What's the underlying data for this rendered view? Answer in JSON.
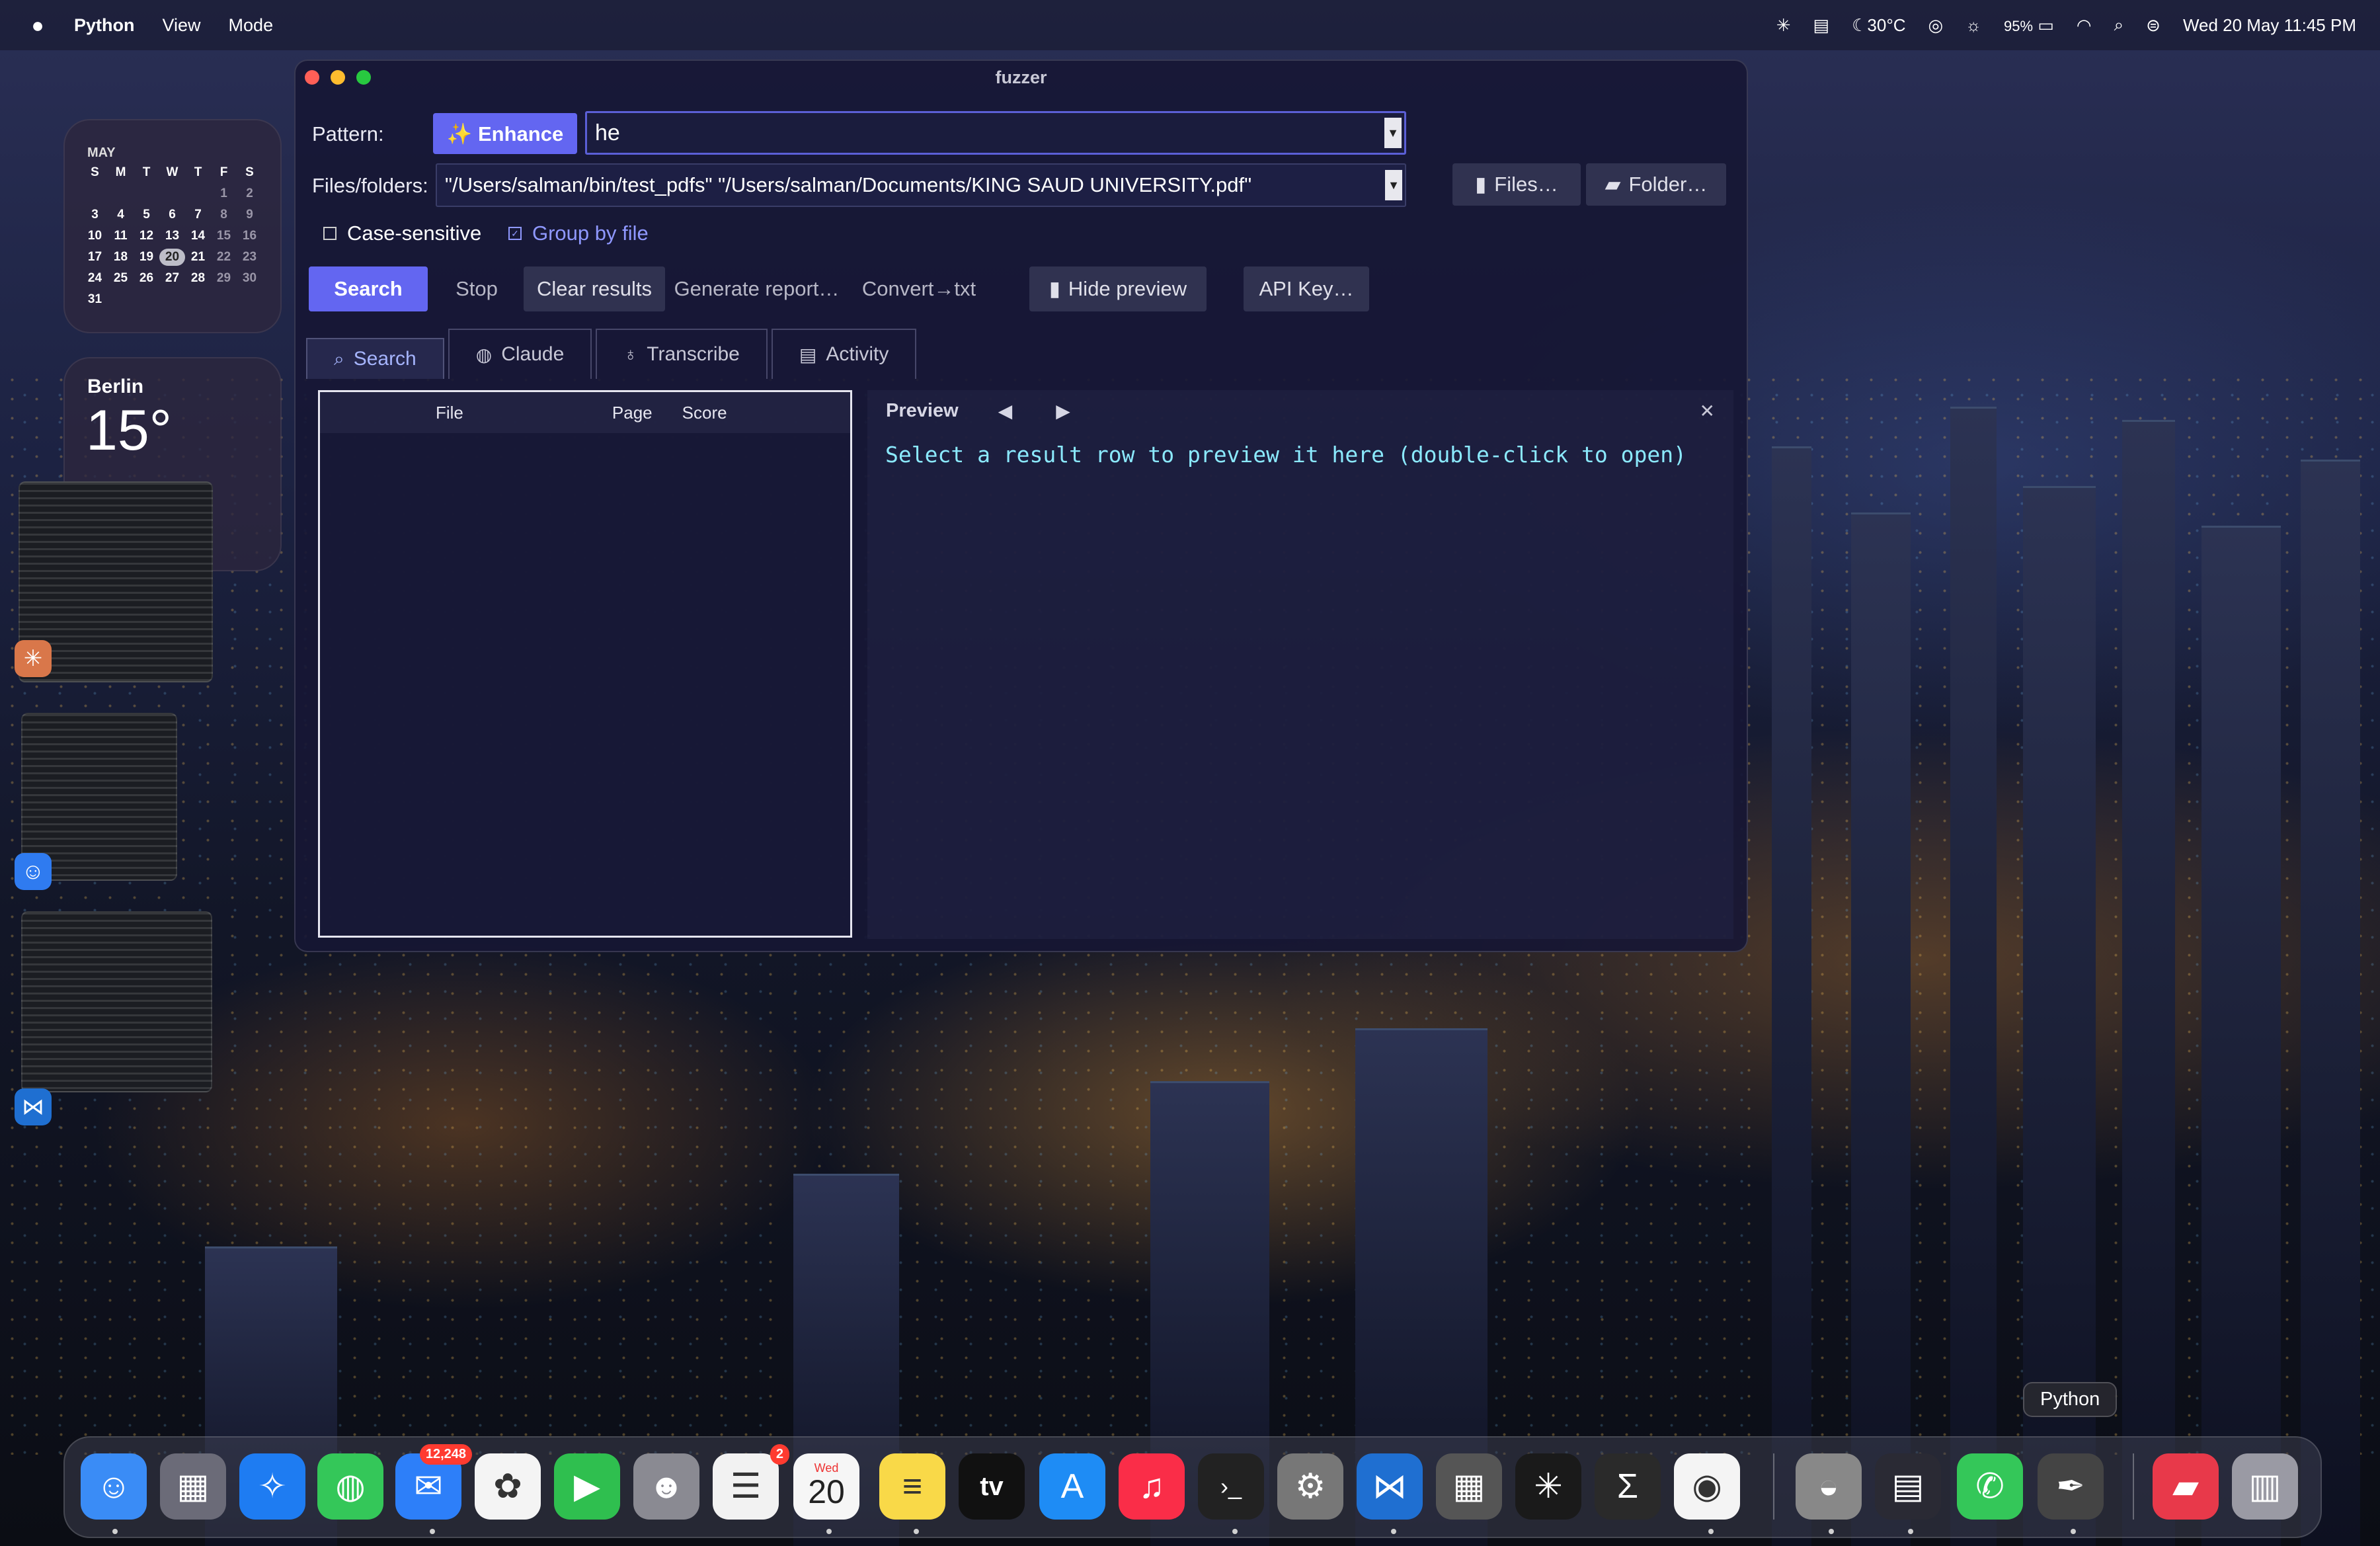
{
  "menubar": {
    "app_name": "Python",
    "menus": [
      "View",
      "Mode"
    ],
    "weather": "30°C",
    "battery": "95%",
    "datetime": "Wed 20 May  11:45 PM"
  },
  "calendar_widget": {
    "month": "MAY",
    "weekdays": [
      "S",
      "M",
      "T",
      "W",
      "T",
      "F",
      "S"
    ],
    "days": [
      "",
      "",
      "",
      "",
      "",
      "1",
      "2",
      "3",
      "4",
      "5",
      "6",
      "7",
      "8",
      "9",
      "10",
      "11",
      "12",
      "13",
      "14",
      "15",
      "16",
      "17",
      "18",
      "19",
      "20",
      "21",
      "22",
      "23",
      "24",
      "25",
      "26",
      "27",
      "28",
      "29",
      "30",
      "31"
    ],
    "today": "20"
  },
  "weather_widget": {
    "city": "Berlin",
    "temperature": "15°"
  },
  "window": {
    "title": "fuzzer",
    "pattern_label": "Pattern:",
    "enhance_label": "✨ Enhance",
    "pattern_value": "he",
    "files_label": "Files/folders:",
    "files_value": "\"/Users/salman/bin/test_pdfs\" \"/Users/salman/Documents/KING SAUD UNIVERSITY.pdf\"",
    "files_button": "Files…",
    "folder_button": "Folder…",
    "case_sensitive_label": "Case-sensitive",
    "group_by_file_label": "Group by file",
    "toolbar": {
      "search": "Search",
      "stop": "Stop",
      "clear": "Clear results",
      "report": "Generate report…",
      "convert": "Convert→txt",
      "hide_preview": "Hide preview",
      "api_key": "API Key…"
    },
    "tabs": [
      "Search",
      "Claude",
      "Transcribe",
      "Activity"
    ],
    "results_columns": [
      "File",
      "Page",
      "Score"
    ],
    "preview_title": "Preview",
    "preview_message": "Select a result row to preview it here (double-click to open)"
  },
  "dock": {
    "tooltip": "Python",
    "mail_badge": "12,248",
    "reminders_badge": "2",
    "calendar_day_label": "Wed",
    "calendar_day_number": "20",
    "tv_label": "tv",
    "icons": [
      "finder-icon",
      "launchpad-icon",
      "safari-icon",
      "messages-icon",
      "mail-icon",
      "photos-icon",
      "facetime-icon",
      "contacts-icon",
      "reminders-icon",
      "calendar-icon",
      "notes-icon",
      "apple-tv-icon",
      "app-store-icon",
      "music-icon",
      "terminal-icon",
      "system-settings-icon",
      "vscode-icon",
      "calculator-icon",
      "claude-icon",
      "sigma-icon",
      "chrome-icon",
      "disk-utility-icon",
      "grid-app-icon",
      "phone-icon",
      "python-launcher-icon",
      "folder-icon",
      "trash-icon"
    ]
  }
}
